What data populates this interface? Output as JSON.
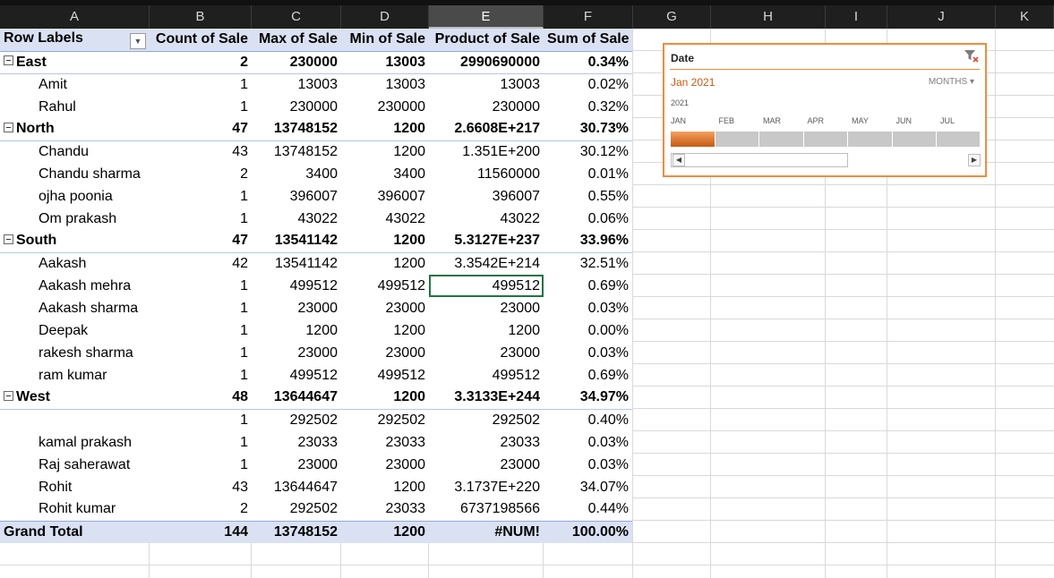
{
  "columns": [
    "A",
    "B",
    "C",
    "D",
    "E",
    "F",
    "G",
    "H",
    "I",
    "J",
    "K"
  ],
  "pivot": {
    "headers": {
      "row_labels": "Row Labels",
      "count": "Count of Sale",
      "max": "Max of Sale",
      "min": "Min of Sale",
      "product": "Product of Sale",
      "sum": "Sum of Sale"
    },
    "rows": [
      {
        "level": "region",
        "label": "East",
        "count": "2",
        "max": "230000",
        "min": "13003",
        "product": "2990690000",
        "sum": "0.34%"
      },
      {
        "level": "child",
        "label": "Amit",
        "count": "1",
        "max": "13003",
        "min": "13003",
        "product": "13003",
        "sum": "0.02%"
      },
      {
        "level": "child",
        "label": "Rahul",
        "count": "1",
        "max": "230000",
        "min": "230000",
        "product": "230000",
        "sum": "0.32%"
      },
      {
        "level": "region",
        "label": "North",
        "count": "47",
        "max": "13748152",
        "min": "1200",
        "product": "2.6608E+217",
        "sum": "30.73%"
      },
      {
        "level": "child",
        "label": "Chandu",
        "count": "43",
        "max": "13748152",
        "min": "1200",
        "product": "1.351E+200",
        "sum": "30.12%"
      },
      {
        "level": "child",
        "label": "Chandu sharma",
        "count": "2",
        "max": "3400",
        "min": "3400",
        "product": "11560000",
        "sum": "0.01%"
      },
      {
        "level": "child",
        "label": "ojha poonia",
        "count": "1",
        "max": "396007",
        "min": "396007",
        "product": "396007",
        "sum": "0.55%"
      },
      {
        "level": "child",
        "label": "Om prakash",
        "count": "1",
        "max": "43022",
        "min": "43022",
        "product": "43022",
        "sum": "0.06%"
      },
      {
        "level": "region",
        "label": "South",
        "count": "47",
        "max": "13541142",
        "min": "1200",
        "product": "5.3127E+237",
        "sum": "33.96%"
      },
      {
        "level": "child",
        "label": "Aakash",
        "count": "42",
        "max": "13541142",
        "min": "1200",
        "product": "3.3542E+214",
        "sum": "32.51%"
      },
      {
        "level": "child",
        "label": "Aakash mehra",
        "count": "1",
        "max": "499512",
        "min": "499512",
        "product": "499512",
        "sum": "0.69%",
        "selected": true
      },
      {
        "level": "child",
        "label": "Aakash sharma",
        "count": "1",
        "max": "23000",
        "min": "23000",
        "product": "23000",
        "sum": "0.03%"
      },
      {
        "level": "child",
        "label": "Deepak",
        "count": "1",
        "max": "1200",
        "min": "1200",
        "product": "1200",
        "sum": "0.00%"
      },
      {
        "level": "child",
        "label": "rakesh sharma",
        "count": "1",
        "max": "23000",
        "min": "23000",
        "product": "23000",
        "sum": "0.03%"
      },
      {
        "level": "child",
        "label": "ram kumar",
        "count": "1",
        "max": "499512",
        "min": "499512",
        "product": "499512",
        "sum": "0.69%"
      },
      {
        "level": "region",
        "label": "West",
        "count": "48",
        "max": "13644647",
        "min": "1200",
        "product": "3.3133E+244",
        "sum": "34.97%"
      },
      {
        "level": "child",
        "label": "",
        "count": "1",
        "max": "292502",
        "min": "292502",
        "product": "292502",
        "sum": "0.40%"
      },
      {
        "level": "child",
        "label": "kamal prakash",
        "count": "1",
        "max": "23033",
        "min": "23033",
        "product": "23033",
        "sum": "0.03%"
      },
      {
        "level": "child",
        "label": "Raj saherawat",
        "count": "1",
        "max": "23000",
        "min": "23000",
        "product": "23000",
        "sum": "0.03%"
      },
      {
        "level": "child",
        "label": "Rohit",
        "count": "43",
        "max": "13644647",
        "min": "1200",
        "product": "3.1737E+220",
        "sum": "34.07%"
      },
      {
        "level": "child",
        "label": "Rohit kumar",
        "count": "2",
        "max": "292502",
        "min": "23033",
        "product": "6737198566",
        "sum": "0.44%"
      }
    ],
    "grand_total": {
      "label": "Grand Total",
      "count": "144",
      "max": "13748152",
      "min": "1200",
      "product": "#NUM!",
      "sum": "100.00%"
    }
  },
  "slicer": {
    "title": "Date",
    "selection": "Jan 2021",
    "level": "MONTHS",
    "year": "2021",
    "months": [
      "JAN",
      "FEB",
      "MAR",
      "APR",
      "MAY",
      "JUN",
      "JUL"
    ],
    "selected_month_index": 0
  },
  "colors": {
    "accent": "#f08b3e",
    "selected_month": "#c55a11",
    "pivot_header": "#dae1f2",
    "cell_select": "#217346"
  }
}
